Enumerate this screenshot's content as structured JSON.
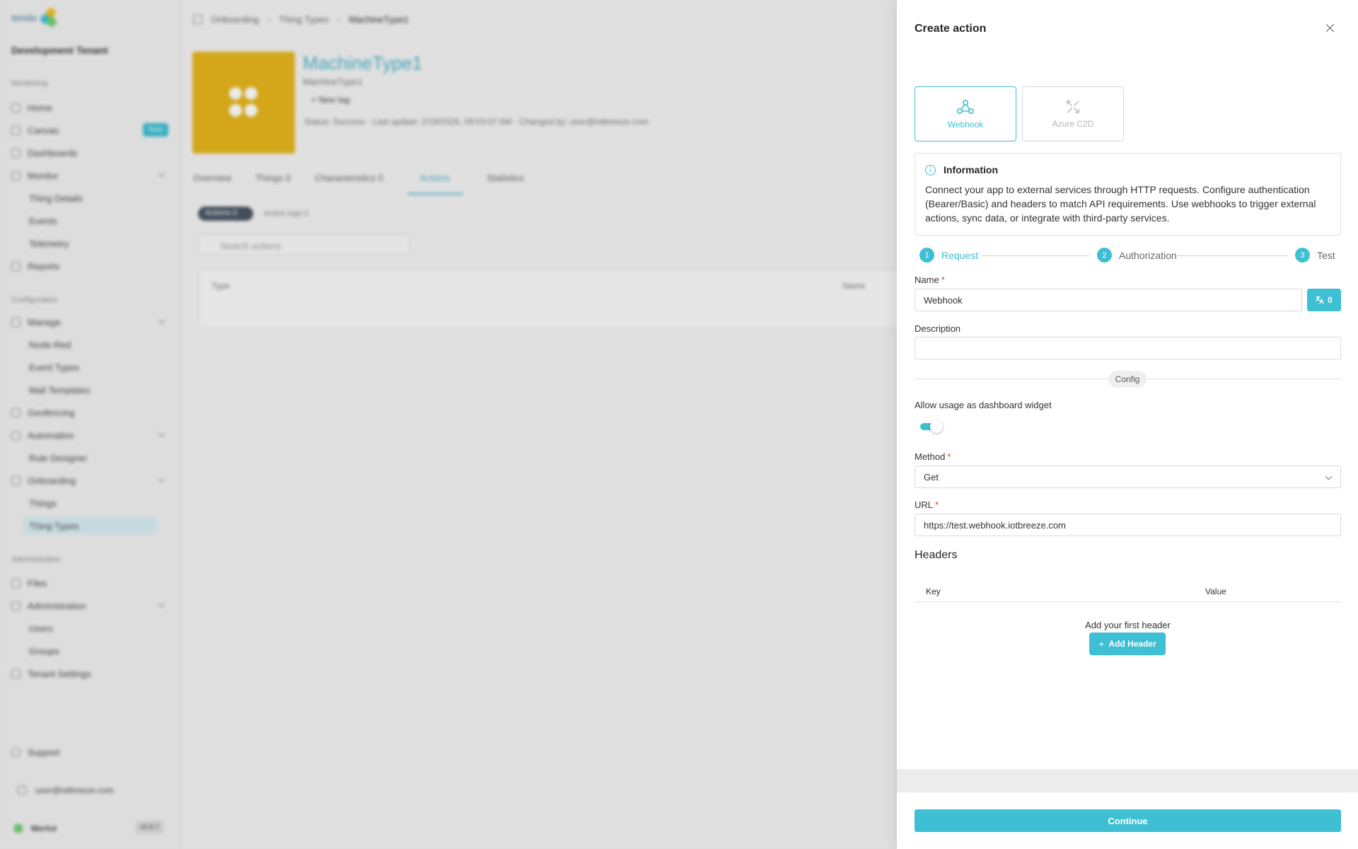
{
  "background": {
    "logo_text": "tendo",
    "tenant": "Development Tenant",
    "sidebar": {
      "monitoring_label": "Monitoring",
      "home": "Home",
      "canvas": "Canvas",
      "canvas_badge": "New",
      "dashboards": "Dashboards",
      "monitor": "Monitor",
      "thing_details": "Thing Details",
      "events": "Events",
      "telemetry": "Telemetry",
      "reports": "Reports",
      "configuration_label": "Configuration",
      "manage": "Manage",
      "node_red": "Node-Red",
      "event_types": "Event Types",
      "mail_templates": "Mail Templates",
      "geofencing": "Geofencing",
      "automation": "Automation",
      "rule_designer": "Rule Designer",
      "onboarding": "Onboarding",
      "things": "Things",
      "thing_types": "Thing Types",
      "administration_label": "Administration",
      "files": "Files",
      "administration": "Administration",
      "users": "Users",
      "groups": "Groups",
      "tenant_settings": "Tenant Settings",
      "support": "Support",
      "user_email": "user@iotbreeze.com",
      "brand": "Merlot",
      "version": "v0.9.7"
    },
    "breadcrumb": [
      "Onboarding",
      "Thing Types",
      "MachineType1"
    ],
    "thing_type": {
      "title": "MachineType1",
      "subtitle": "MachineType1",
      "add_tag": "New tag",
      "meta": "Status: Success · Last update: 2/19/2026, 09:03:07 AM · Changed by: user@iotbreeze.com"
    },
    "tabs": [
      "Overview",
      "Things  0",
      "Characteristics  0",
      "Actions",
      "Statistics"
    ],
    "filters": {
      "pill": "Actions 0",
      "other": "Action logs  0"
    },
    "search_placeholder": "Search actions",
    "table_headers": [
      "Type",
      "Name"
    ]
  },
  "drawer": {
    "title": "Create action",
    "types": [
      {
        "label": "Webhook",
        "icon": "webhook-icon",
        "selected": true
      },
      {
        "label": "Azure C2D",
        "icon": "azure-c2d-icon",
        "selected": false
      }
    ],
    "info": {
      "heading": "Information",
      "text": "Connect your app to external services through HTTP requests. Configure authentication (Bearer/Basic) and headers to match API requirements. Use webhooks to trigger external actions, sync data, or integrate with third-party services."
    },
    "steps": [
      {
        "num": "1",
        "label": "Request"
      },
      {
        "num": "2",
        "label": "Authorization"
      },
      {
        "num": "3",
        "label": "Test"
      }
    ],
    "name_label": "Name",
    "name_value": "Webhook",
    "translate_count": "0",
    "description_label": "Description",
    "description_value": "",
    "config_label": "Config",
    "widget_label": "Allow usage as dashboard widget",
    "widget_enabled": true,
    "method_label": "Method",
    "method_value": "Get",
    "url_label": "URL",
    "url_value": "https://test.webhook.iotbreeze.com",
    "headers_title": "Headers",
    "headers_columns": [
      "Key",
      "Value"
    ],
    "headers_empty": "Add your first header",
    "add_header_label": "Add Header",
    "continue_label": "Continue",
    "accent_color": "#3fbfd3",
    "required_mark": "*"
  }
}
